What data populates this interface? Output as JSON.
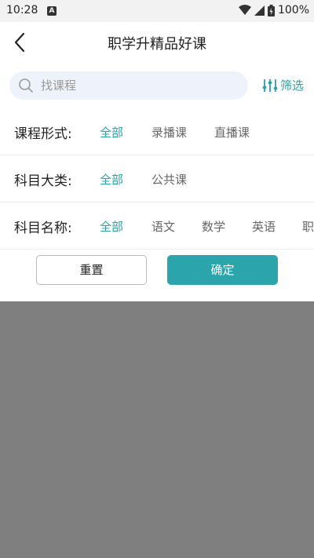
{
  "status_bar": {
    "time": "10:28",
    "battery": "100%"
  },
  "header": {
    "title": "职学升精品好课"
  },
  "search": {
    "placeholder": "找课程",
    "value": "",
    "filter_label": "筛选"
  },
  "filters": {
    "course_form": {
      "label": "课程形式:",
      "options": [
        "全部",
        "录播课",
        "直播课"
      ],
      "selected": "全部"
    },
    "subject_category": {
      "label": "科目大类:",
      "options": [
        "全部",
        "公共课"
      ],
      "selected": "全部"
    },
    "subject_name": {
      "label": "科目名称:",
      "options": [
        "全部",
        "语文",
        "数学",
        "英语",
        "职"
      ],
      "selected": "全部"
    }
  },
  "actions": {
    "reset_label": "重置",
    "confirm_label": "确定"
  },
  "colors": {
    "accent": "#2aa2a8",
    "overlay": "#7f7f7f"
  }
}
